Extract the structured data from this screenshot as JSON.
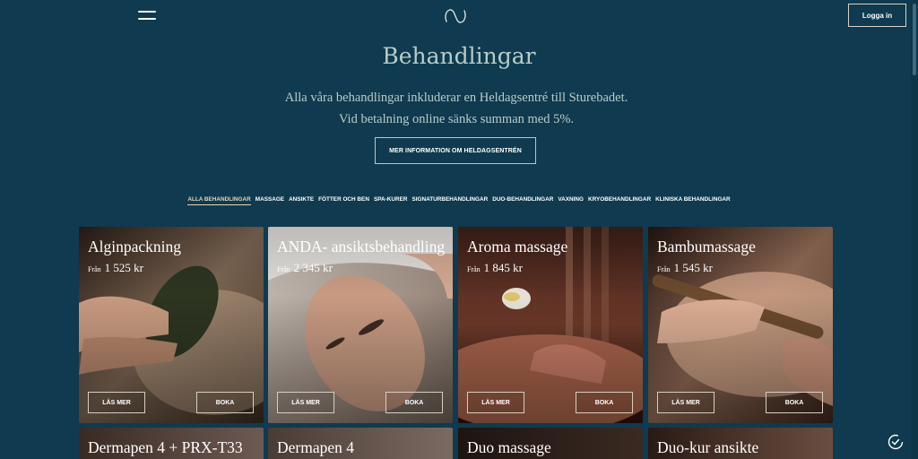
{
  "header": {
    "login_label": "Logga in",
    "icons": {
      "menu": "hamburger-menu-icon",
      "logo": "brand-logo-icon"
    }
  },
  "main": {
    "title": "Behandlingar",
    "intro_line1": "Alla våra behandlingar inkluderar en Heldagsentré till Sturebadet.",
    "intro_line2": "Vid betalning online sänks summan med 5%.",
    "info_button": "MER INFORMATION OM HELDAGSENTRÉN"
  },
  "filters": [
    {
      "label": "ALLA BEHANDLINGAR",
      "active": true
    },
    {
      "label": "MASSAGE",
      "active": false
    },
    {
      "label": "ANSIKTE",
      "active": false
    },
    {
      "label": "FÖTTER OCH BEN",
      "active": false
    },
    {
      "label": "SPA-KURER",
      "active": false
    },
    {
      "label": "SIGNATURBEHANDLINGAR",
      "active": false
    },
    {
      "label": "DUO-BEHANDLINGAR",
      "active": false
    },
    {
      "label": "VAXNING",
      "active": false
    },
    {
      "label": "KRYOBEHANDLINGAR",
      "active": false
    },
    {
      "label": "KLINISKA BEHANDLINGAR",
      "active": false
    }
  ],
  "cards": [
    {
      "title": "Alginpackning",
      "price_prefix": "Från",
      "price": "1 525 kr",
      "more_label": "LÄS MER",
      "book_label": "BOKA"
    },
    {
      "title": "ANDA- ansiktsbehandling",
      "price_prefix": "Från",
      "price": "2 345 kr",
      "more_label": "LÄS MER",
      "book_label": "BOKA"
    },
    {
      "title": "Aroma massage",
      "price_prefix": "Från",
      "price": "1 845 kr",
      "more_label": "LÄS MER",
      "book_label": "BOKA"
    },
    {
      "title": "Bambumassage",
      "price_prefix": "Från",
      "price": "1 545 kr",
      "more_label": "LÄS MER",
      "book_label": "BOKA"
    }
  ],
  "next_cards": [
    {
      "title": "Dermapen 4 + PRX-T33"
    },
    {
      "title": "Dermapen 4"
    },
    {
      "title": "Duo massage"
    },
    {
      "title": "Duo-kur ansikte"
    }
  ],
  "colors": {
    "background": "#0f3a4f",
    "heading": "#b9ccc9",
    "active_tab": "#e6d6b7",
    "button_border": "#d6cfbf"
  },
  "floating": {
    "consent_icon": "cookie-consent-icon"
  }
}
